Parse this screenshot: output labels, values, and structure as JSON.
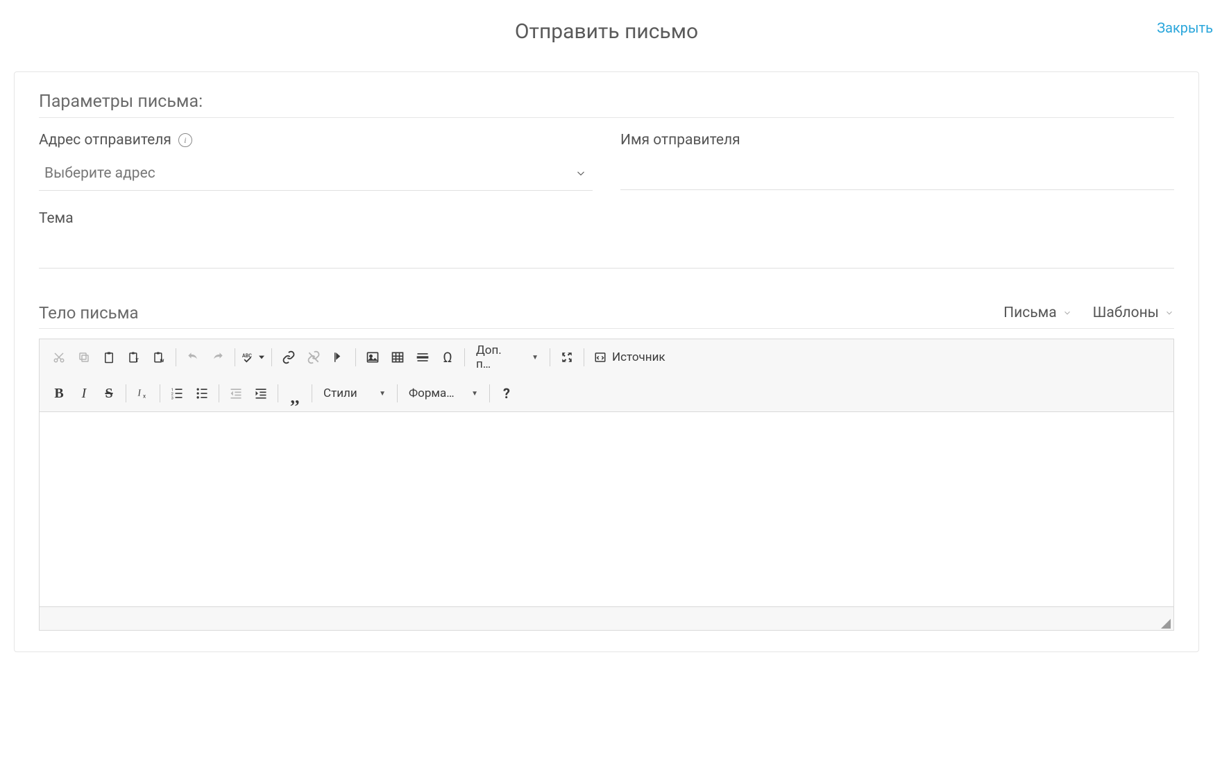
{
  "header": {
    "title": "Отправить письмо",
    "close": "Закрыть"
  },
  "params": {
    "section_title": "Параметры письма:",
    "sender_address_label": "Адрес отправителя",
    "sender_address_placeholder": "Выберите адрес",
    "sender_name_label": "Имя отправителя",
    "sender_name_value": "",
    "subject_label": "Тема",
    "subject_value": ""
  },
  "body": {
    "title": "Тело письма",
    "letters_dropdown": "Письма",
    "templates_dropdown": "Шаблоны"
  },
  "toolbar": {
    "extras_label": "Доп. п…",
    "source_label": "Источник",
    "styles_label": "Стили",
    "format_label": "Форма…"
  }
}
